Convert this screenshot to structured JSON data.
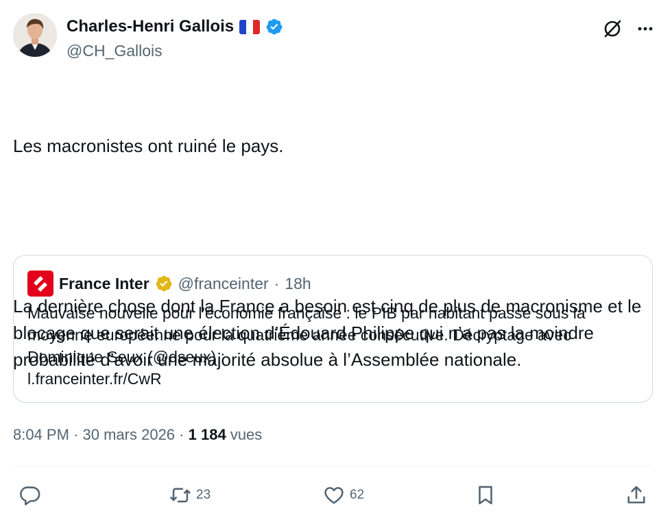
{
  "author": {
    "name": "Charles-Henri Gallois",
    "handle": "@CH_Gallois"
  },
  "tweet": {
    "paragraph1": "Les macronistes ont ruiné le pays.",
    "paragraph2": "La dernière chose dont la France a besoin est cinq de plus de macronisme et le blocage que serait une élection d’Édouard Philippe qui n’a pas la moindre probabilité d’avoir une majorité absolue à l’Assemblée nationale."
  },
  "quote": {
    "name": "France Inter",
    "handle": "@franceinter",
    "separator": "·",
    "time": "18h",
    "line1": "Mauvaise nouvelle pour l'économie française : le PIB par habitant passe sous la",
    "line2": "moyenne européenne pour la quatrième année consécutive. Décryptage avec",
    "line3": "Dominique Seux (@dseux) :",
    "link": "l.franceinter.fr/CwR"
  },
  "meta": {
    "time": "8:04 PM",
    "sep1": "·",
    "date": "30 mars 2026",
    "sep2": "·",
    "views_count": "1 184",
    "views_label": "vues"
  },
  "actions": {
    "retweets": "23",
    "likes": "62"
  },
  "colors": {
    "verified_blue": "#1d9bf0",
    "verified_gold": "#e2b719",
    "france_inter_red": "#e2001a",
    "secondary_text": "#536471"
  },
  "icons": [
    "verified-badge-icon",
    "grok-icon",
    "more-icon",
    "reply-icon",
    "retweet-icon",
    "like-icon",
    "bookmark-icon",
    "share-icon"
  ]
}
